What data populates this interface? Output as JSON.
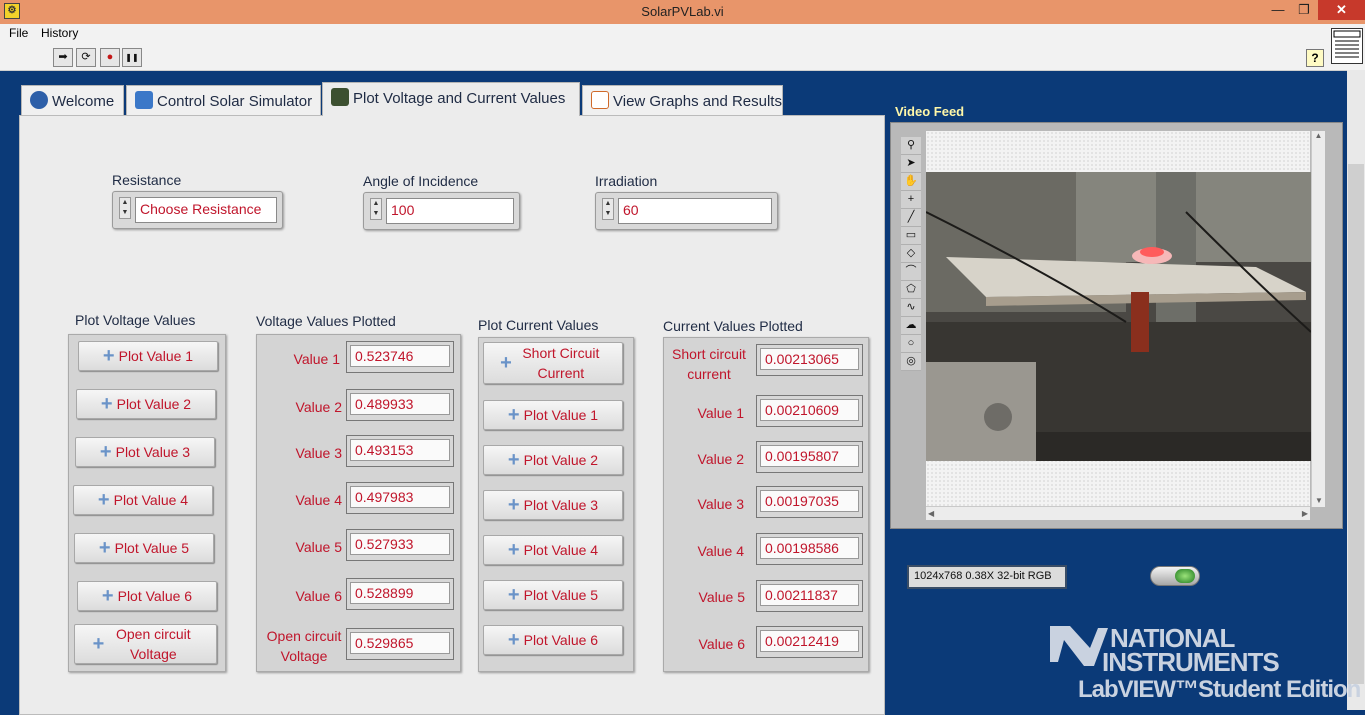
{
  "window": {
    "title": "SolarPVLab.vi",
    "minimize": "—",
    "restore": "❐",
    "close": "✕"
  },
  "menu": [
    "File",
    "History"
  ],
  "toolbar": {
    "run": "➡",
    "run_continuous": "⟳",
    "abort": "●",
    "pause": "❚❚",
    "help": "?"
  },
  "tabs": [
    {
      "label": "Welcome",
      "icon": "home-icon",
      "color": "#2d5fa8"
    },
    {
      "label": "Control Solar Simulator",
      "icon": "control-icon",
      "color": "#3b78c8"
    },
    {
      "label": "Plot Voltage and Current Values",
      "icon": "chart-icon",
      "color": "#3c5030"
    },
    {
      "label": "View Graphs and Results",
      "icon": "graph-icon",
      "color": "#d06a2a"
    }
  ],
  "active_tab": 2,
  "inputs": {
    "resistance": {
      "label": "Resistance",
      "value": "Choose Resistance"
    },
    "angle": {
      "label": "Angle of Incidence",
      "value": "100"
    },
    "irradiation": {
      "label": "Irradiation",
      "value": "60"
    }
  },
  "voltage": {
    "plot_title": "Plot Voltage Values",
    "plotted_title": "Voltage Values Plotted",
    "buttons": [
      "Plot Value 1",
      "Plot Value 2",
      "Plot Value 3",
      "Plot Value 4",
      "Plot Value 5",
      "Plot Value 6",
      "Open circuit Voltage"
    ],
    "rows": [
      {
        "label": "Value 1",
        "value": "0.523746"
      },
      {
        "label": "Value 2",
        "value": "0.489933"
      },
      {
        "label": "Value 3",
        "value": "0.493153"
      },
      {
        "label": "Value 4",
        "value": "0.497983"
      },
      {
        "label": "Value 5",
        "value": "0.527933"
      },
      {
        "label": "Value 6",
        "value": "0.528899"
      },
      {
        "label": "Open circuit Voltage",
        "value": "0.529865"
      }
    ]
  },
  "current": {
    "plot_title": "Plot Current Values",
    "plotted_title": "Current Values Plotted",
    "buttons": [
      "Short Circuit Current",
      "Plot Value 1",
      "Plot Value 2",
      "Plot Value 3",
      "Plot Value 4",
      "Plot Value 5",
      "Plot Value 6"
    ],
    "rows": [
      {
        "label": "Short circuit current",
        "value": "0.00213065"
      },
      {
        "label": "Value 1",
        "value": "0.00210609"
      },
      {
        "label": "Value 2",
        "value": "0.00195807"
      },
      {
        "label": "Value 3",
        "value": "0.00197035"
      },
      {
        "label": "Value 4",
        "value": "0.00198586"
      },
      {
        "label": "Value 5",
        "value": "0.00211837"
      },
      {
        "label": "Value 6",
        "value": "0.00212419"
      }
    ]
  },
  "video": {
    "label": "Video Feed",
    "image_info": "1024x768 0.38X 32-bit RGB"
  },
  "branding": {
    "line1": "NATIONAL",
    "line2": "INSTRUMENTS",
    "line3": "LabVIEW™Student Edition"
  },
  "colors": {
    "background": "#0b3a78",
    "title_bar": "#e8956a",
    "value_text": "#c0152b",
    "video_label": "#fff7a8"
  }
}
